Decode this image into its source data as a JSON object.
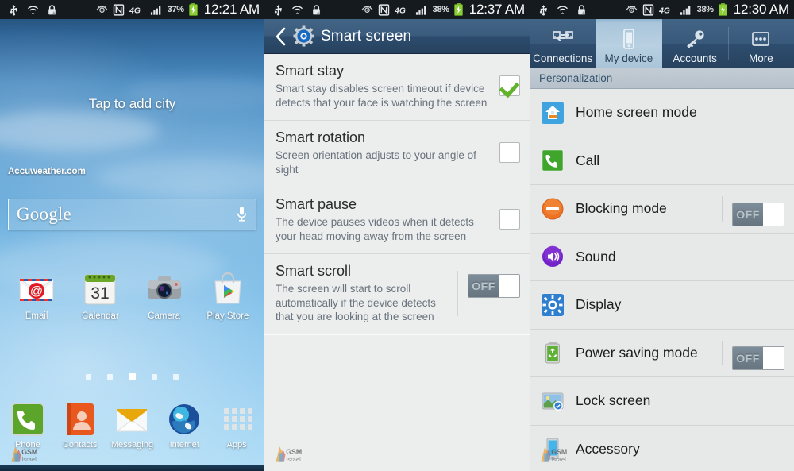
{
  "screens": [
    {
      "id": "home-screen",
      "statusbar": {
        "icons": [
          "usb-icon",
          "wifi-direct-icon",
          "lock-icon",
          "eye-icon",
          "nfc-icon",
          "4g-icon",
          "signal-icon"
        ],
        "battery_pct": "37%",
        "clock": "12:21 AM"
      },
      "widget": {
        "title": "Tap to add city",
        "source": "Accuweather.com"
      },
      "search": {
        "logo": "Google",
        "mic": "microphone-icon"
      },
      "apps": [
        {
          "label": "Email",
          "icon": "email-icon"
        },
        {
          "label": "Calendar",
          "icon": "calendar-icon",
          "day": "31"
        },
        {
          "label": "Camera",
          "icon": "camera-icon"
        },
        {
          "label": "Play Store",
          "icon": "play-store-icon"
        }
      ],
      "page_dots": {
        "count": 5,
        "active_index": 2
      },
      "dock": [
        {
          "label": "Phone",
          "icon": "phone-icon"
        },
        {
          "label": "Contacts",
          "icon": "contacts-icon"
        },
        {
          "label": "Messaging",
          "icon": "messaging-icon"
        },
        {
          "label": "Internet",
          "icon": "internet-icon"
        },
        {
          "label": "Apps",
          "icon": "apps-grid-icon"
        }
      ],
      "watermark": {
        "line1": "GSM",
        "line2": "Israel"
      }
    },
    {
      "id": "smart-screen",
      "statusbar": {
        "icons": [
          "usb-icon",
          "wifi-direct-icon",
          "lock-icon",
          "eye-icon",
          "nfc-icon",
          "4g-icon",
          "signal-icon"
        ],
        "battery_pct": "38%",
        "clock": "12:37 AM"
      },
      "actionbar": {
        "back": "back-chevron-icon",
        "icon": "settings-gear-icon",
        "title": "Smart screen"
      },
      "items": [
        {
          "title": "Smart stay",
          "subtitle": "Smart stay disables screen timeout if device detects that your face is watching the screen",
          "control": "checkbox",
          "checked": true
        },
        {
          "title": "Smart rotation",
          "subtitle": "Screen orientation adjusts to your angle of sight",
          "control": "checkbox",
          "checked": false
        },
        {
          "title": "Smart pause",
          "subtitle": "The device pauses videos when it detects your head moving away from the screen",
          "control": "checkbox",
          "checked": false
        },
        {
          "title": "Smart scroll",
          "subtitle": "The screen will start to scroll automatically if the device detects that you are looking at the screen",
          "control": "toggle",
          "toggle_label": "OFF"
        }
      ],
      "watermark": {
        "line1": "GSM",
        "line2": "Israel"
      }
    },
    {
      "id": "settings-my-device",
      "statusbar": {
        "icons": [
          "usb-icon",
          "wifi-direct-icon",
          "lock-icon",
          "eye-icon",
          "nfc-icon",
          "4g-icon",
          "signal-icon"
        ],
        "battery_pct": "38%",
        "clock": "12:30 AM"
      },
      "tabs": [
        {
          "label": "Connections",
          "icon": "connections-icon",
          "active": false
        },
        {
          "label": "My device",
          "icon": "device-icon",
          "active": true
        },
        {
          "label": "Accounts",
          "icon": "key-icon",
          "active": false
        },
        {
          "label": "More",
          "icon": "more-dots-icon",
          "active": false
        }
      ],
      "section": "Personalization",
      "items": [
        {
          "label": "Home screen mode",
          "icon": "home-screen-mode-icon",
          "control": "none"
        },
        {
          "label": "Call",
          "icon": "call-icon",
          "control": "none"
        },
        {
          "label": "Blocking mode",
          "icon": "blocking-mode-icon",
          "control": "toggle",
          "toggle_label": "OFF"
        },
        {
          "label": "Sound",
          "icon": "sound-icon",
          "control": "none"
        },
        {
          "label": "Display",
          "icon": "display-icon",
          "control": "none"
        },
        {
          "label": "Power saving mode",
          "icon": "power-saving-icon",
          "control": "toggle",
          "toggle_label": "OFF"
        },
        {
          "label": "Lock screen",
          "icon": "lock-screen-icon",
          "control": "none"
        },
        {
          "label": "Accessory",
          "icon": "accessory-icon",
          "control": "none"
        }
      ],
      "watermark": {
        "line1": "GSM",
        "line2": "Israel"
      }
    }
  ],
  "colors": {
    "status_bg": "#151a1e",
    "actionbar": "#3a5b7d",
    "tab_active": "#b8d0e1",
    "section_bg": "#bcc6cf",
    "list_bg": "#e7e8e8",
    "check_green": "#62b32c",
    "toggle_off": "#6f7f8a"
  }
}
